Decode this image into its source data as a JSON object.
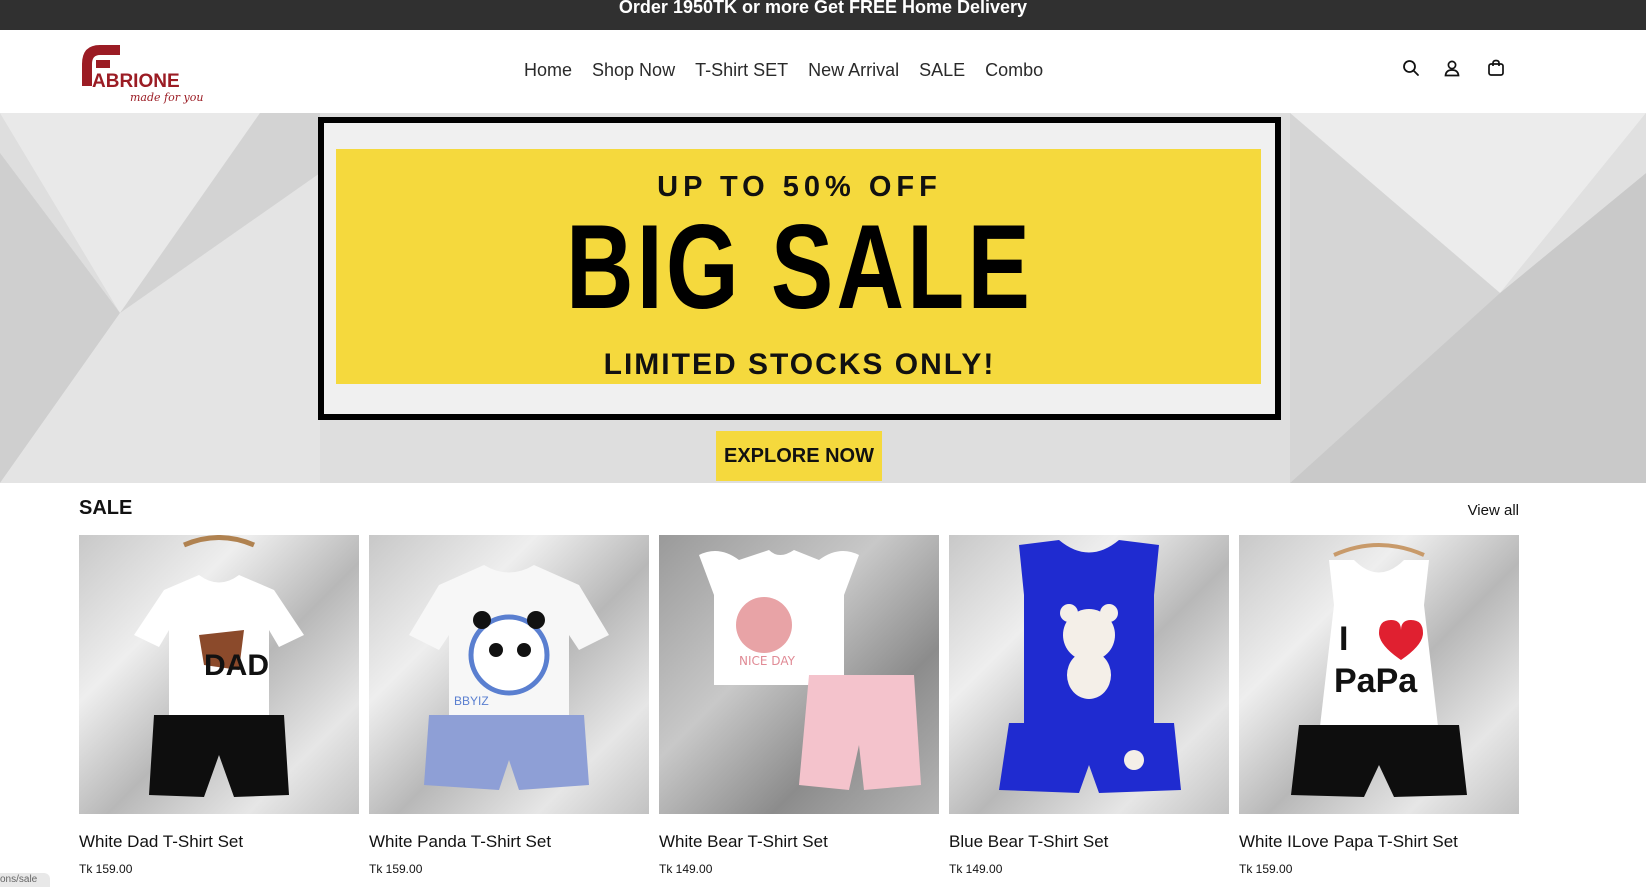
{
  "announcement": "Order 1950TK or more Get FREE Home Delivery",
  "brand": {
    "name": "FABRIONE",
    "tagline": "made for you",
    "color": "#9b1c24"
  },
  "nav": [
    {
      "label": "Home"
    },
    {
      "label": "Shop Now"
    },
    {
      "label": "T-Shirt SET"
    },
    {
      "label": "New Arrival"
    },
    {
      "label": "SALE"
    },
    {
      "label": "Combo"
    }
  ],
  "header_icons": [
    "search-icon",
    "account-icon",
    "cart-icon"
  ],
  "hero": {
    "kicker": "UP TO 50% OFF",
    "headline": "BIG SALE",
    "subline": "LIMITED STOCKS ONLY!",
    "cta": "EXPLORE NOW",
    "accent": "#f5d93d"
  },
  "section": {
    "title": "SALE",
    "view_all": "View all"
  },
  "products": [
    {
      "name": "White Dad T-Shirt Set",
      "price": "Tk 159.00",
      "top": "#ffffff",
      "bottom": "#111111",
      "print": "DAD"
    },
    {
      "name": "White Panda T-Shirt Set",
      "price": "Tk 159.00",
      "top": "#f7f7f7",
      "bottom": "#8e9fd6",
      "print": "BBYIZ"
    },
    {
      "name": "White Bear T-Shirt Set",
      "price": "Tk 149.00",
      "top": "#ffffff",
      "bottom": "#f4c3cc",
      "print": "NICE DAY"
    },
    {
      "name": "Blue Bear T-Shirt Set",
      "price": "Tk 149.00",
      "top": "#1f2bd0",
      "bottom": "#1f2bd0",
      "print": ""
    },
    {
      "name": "White ILove Papa T-Shirt Set",
      "price": "Tk 159.00",
      "top": "#ffffff",
      "bottom": "#111111",
      "print": "I ♥ PaPa"
    }
  ],
  "status_url": "ons/sale"
}
